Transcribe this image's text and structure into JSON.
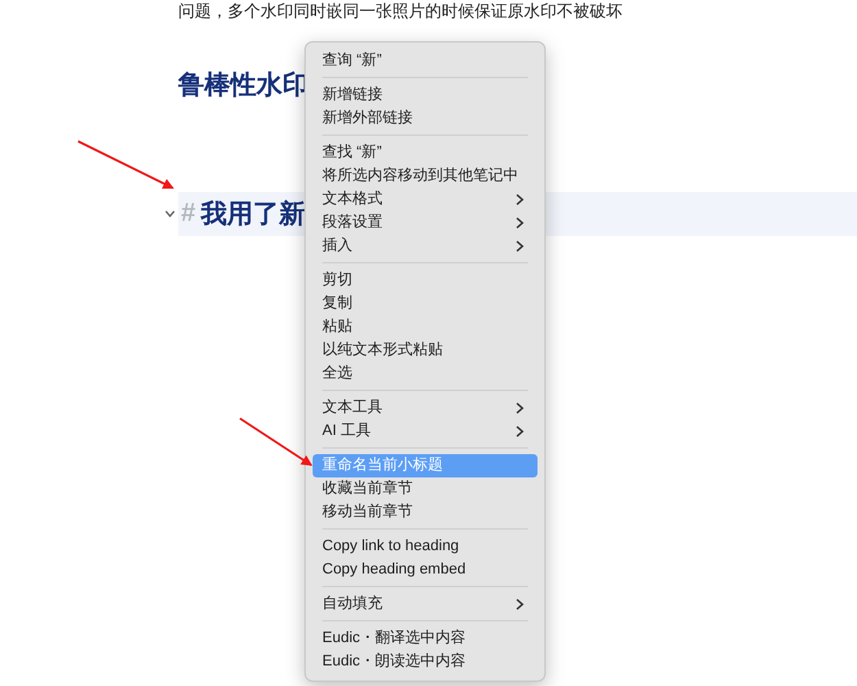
{
  "document": {
    "paragraph": "问题，多个水印同时嵌同一张照片的时候保证原水印不被破坏",
    "headings": [
      {
        "text": "鲁棒性水印",
        "selected": false,
        "collapsible": false
      },
      {
        "hash": "#",
        "text": "我用了新",
        "selected": true,
        "collapsible": true
      }
    ]
  },
  "context_menu": {
    "groups": [
      [
        {
          "label": "查询 “新”",
          "submenu": false,
          "selected": false
        }
      ],
      [
        {
          "label": "新增链接",
          "submenu": false,
          "selected": false
        },
        {
          "label": "新增外部链接",
          "submenu": false,
          "selected": false
        }
      ],
      [
        {
          "label": "查找 “新”",
          "submenu": false,
          "selected": false
        },
        {
          "label": "将所选内容移动到其他笔记中",
          "submenu": false,
          "selected": false
        },
        {
          "label": "文本格式",
          "submenu": true,
          "selected": false
        },
        {
          "label": "段落设置",
          "submenu": true,
          "selected": false
        },
        {
          "label": "插入",
          "submenu": true,
          "selected": false
        }
      ],
      [
        {
          "label": "剪切",
          "submenu": false,
          "selected": false
        },
        {
          "label": "复制",
          "submenu": false,
          "selected": false
        },
        {
          "label": "粘贴",
          "submenu": false,
          "selected": false
        },
        {
          "label": "以纯文本形式粘贴",
          "submenu": false,
          "selected": false
        },
        {
          "label": "全选",
          "submenu": false,
          "selected": false
        }
      ],
      [
        {
          "label": "文本工具",
          "submenu": true,
          "selected": false
        },
        {
          "label": "AI 工具",
          "submenu": true,
          "selected": false
        }
      ],
      [
        {
          "label": "重命名当前小标题",
          "submenu": false,
          "selected": true
        },
        {
          "label": "收藏当前章节",
          "submenu": false,
          "selected": false
        },
        {
          "label": "移动当前章节",
          "submenu": false,
          "selected": false
        }
      ],
      [
        {
          "label": "Copy link to heading",
          "submenu": false,
          "selected": false
        },
        {
          "label": "Copy heading embed",
          "submenu": false,
          "selected": false
        }
      ],
      [
        {
          "label": "自动填充",
          "submenu": true,
          "selected": false
        }
      ],
      [
        {
          "label": "Eudic・翻译选中内容",
          "submenu": false,
          "selected": false
        },
        {
          "label": "Eudic・朗读选中内容",
          "submenu": false,
          "selected": false
        }
      ]
    ]
  }
}
